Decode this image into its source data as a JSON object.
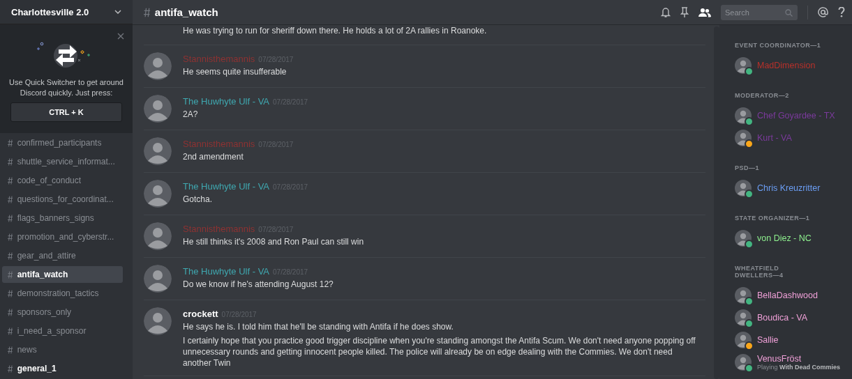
{
  "server": {
    "name": "Charlottesville 2.0"
  },
  "popup": {
    "text": "Use Quick Switcher to get around Discord quickly. Just press:",
    "shortcut": "CTRL + K"
  },
  "channels": [
    {
      "name": "confirmed_participants",
      "selected": false,
      "unread": false
    },
    {
      "name": "shuttle_service_informat...",
      "selected": false,
      "unread": false
    },
    {
      "name": "code_of_conduct",
      "selected": false,
      "unread": false
    },
    {
      "name": "questions_for_coordinat...",
      "selected": false,
      "unread": false
    },
    {
      "name": "flags_banners_signs",
      "selected": false,
      "unread": false
    },
    {
      "name": "promotion_and_cyberstr...",
      "selected": false,
      "unread": false
    },
    {
      "name": "gear_and_attire",
      "selected": false,
      "unread": false
    },
    {
      "name": "antifa_watch",
      "selected": true,
      "unread": false
    },
    {
      "name": "demonstration_tactics",
      "selected": false,
      "unread": false
    },
    {
      "name": "sponsors_only",
      "selected": false,
      "unread": false
    },
    {
      "name": "i_need_a_sponsor",
      "selected": false,
      "unread": false
    },
    {
      "name": "news",
      "selected": false,
      "unread": false
    },
    {
      "name": "general_1",
      "selected": false,
      "unread": true
    }
  ],
  "header": {
    "channel": "antifa_watch",
    "search_placeholder": "Search"
  },
  "messages": [
    {
      "lines": [
        "He was trying to run for sheriff down there. He holds a lot of 2A rallies in Roanoke."
      ]
    },
    {
      "author": "Stannisthemannis",
      "color": "#8e3232",
      "timestamp": "07/28/2017",
      "lines": [
        "He seems quite insufferable"
      ]
    },
    {
      "author": "The Huwhyte Ulf - VA",
      "color": "#3fa8b0",
      "timestamp": "07/28/2017",
      "lines": [
        "2A?"
      ]
    },
    {
      "author": "Stannisthemannis",
      "color": "#8e3232",
      "timestamp": "07/28/2017",
      "lines": [
        "2nd amendment"
      ]
    },
    {
      "author": "The Huwhyte Ulf - VA",
      "color": "#3fa8b0",
      "timestamp": "07/28/2017",
      "lines": [
        "Gotcha."
      ]
    },
    {
      "author": "Stannisthemannis",
      "color": "#8e3232",
      "timestamp": "07/28/2017",
      "lines": [
        "He still thinks it's 2008 and Ron Paul can still win"
      ]
    },
    {
      "author": "The Huwhyte Ulf - VA",
      "color": "#3fa8b0",
      "timestamp": "07/28/2017",
      "lines": [
        "Do we know if he's attending August 12?"
      ]
    },
    {
      "author": "crockett",
      "color": "#ffffff",
      "timestamp": "07/28/2017",
      "lines": [
        "He says he is. I told him that he'll be standing with Antifa if he does show.",
        "I certainly hope that you practice good trigger discipline when you're standing amongst the Antifa Scum. We don't need anyone popping off unnecessary rounds and getting innocent people killed. The police will already be on edge dealing with the Commies. We don't need another Twin"
      ]
    }
  ],
  "member_groups": [
    {
      "title": "EVENT COORDINATOR—1",
      "members": [
        {
          "name": "MadDimension",
          "color": "#b8302a",
          "idle": false
        }
      ]
    },
    {
      "title": "MODERATOR—2",
      "members": [
        {
          "name": "Chef Goyardee - TX",
          "color": "#7b3a9c",
          "idle": false
        },
        {
          "name": "Kurt - VA",
          "color": "#7b3a9c",
          "idle": true
        }
      ]
    },
    {
      "title": "PSD—1",
      "members": [
        {
          "name": "Chris Kreuzritter",
          "color": "#6b9ef5",
          "idle": false
        }
      ]
    },
    {
      "title": "STATE ORGANIZER—1",
      "members": [
        {
          "name": "von Diez - NC",
          "color": "#8ef08e",
          "idle": false
        }
      ]
    },
    {
      "title": "WHEATFIELD DWELLERS—4",
      "members": [
        {
          "name": "BellaDashwood",
          "color": "#f0a0d8",
          "idle": false
        },
        {
          "name": "Boudica - VA",
          "color": "#f0a0d8",
          "idle": false
        },
        {
          "name": "Sallie",
          "color": "#f0a0d8",
          "idle": true
        },
        {
          "name": "VenusFröst",
          "color": "#f0a0d8",
          "idle": false,
          "activity": "Playing **With Dead Commies**"
        }
      ]
    }
  ]
}
